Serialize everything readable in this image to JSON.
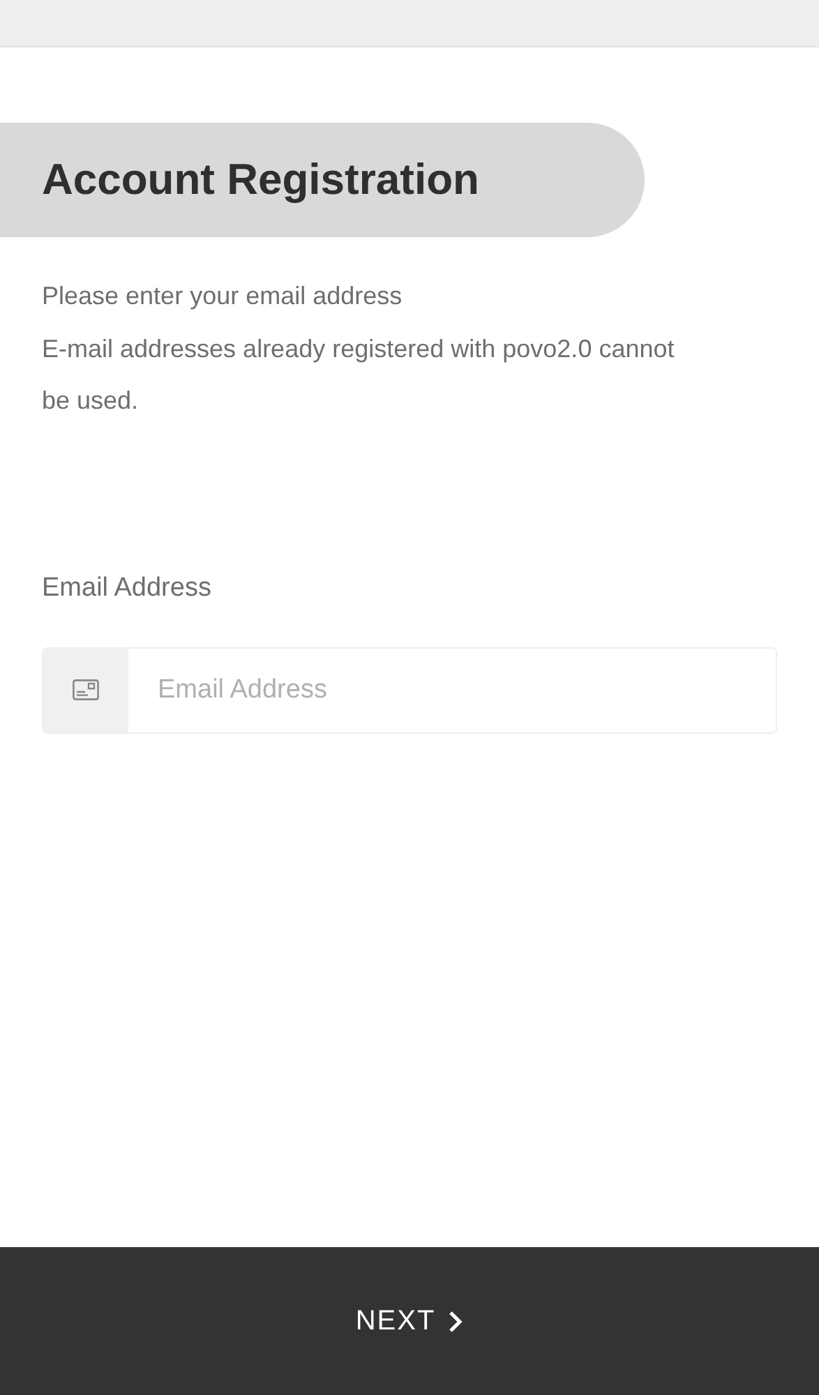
{
  "title": "Account Registration",
  "description": [
    "Please enter your email address",
    "E-mail addresses already registered with povo2.0 cannot be used."
  ],
  "email_field": {
    "label": "Email Address",
    "placeholder": "Email Address"
  },
  "next_button": {
    "label": "NEXT"
  }
}
